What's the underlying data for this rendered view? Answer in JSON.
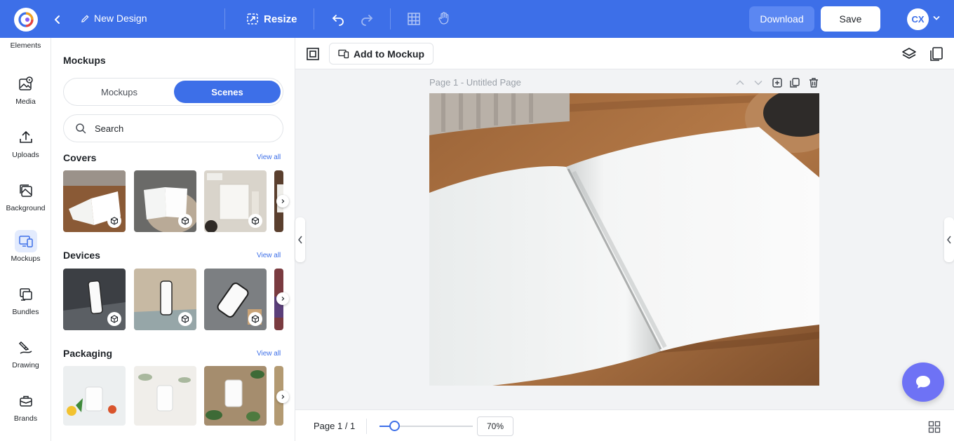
{
  "topbar": {
    "title": "New Design",
    "resize_label": "Resize",
    "download_label": "Download",
    "save_label": "Save",
    "avatar_initials": "CX"
  },
  "rail": {
    "items": [
      {
        "label": "Elements",
        "icon": "elements-icon"
      },
      {
        "label": "Media",
        "icon": "media-icon"
      },
      {
        "label": "Uploads",
        "icon": "upload-icon"
      },
      {
        "label": "Background",
        "icon": "background-icon"
      },
      {
        "label": "Mockups",
        "icon": "mockups-icon",
        "active": true
      },
      {
        "label": "Bundles",
        "icon": "bundles-icon"
      },
      {
        "label": "Drawing",
        "icon": "drawing-icon"
      },
      {
        "label": "Brands",
        "icon": "brands-icon"
      }
    ]
  },
  "panel": {
    "title": "Mockups",
    "tabs": [
      "Mockups",
      "Scenes"
    ],
    "active_tab": "Scenes",
    "search_placeholder": "Search",
    "view_all": "View all",
    "sections": [
      {
        "title": "Covers"
      },
      {
        "title": "Devices"
      },
      {
        "title": "Packaging"
      }
    ]
  },
  "canvas": {
    "add_to_mockup_label": "Add to Mockup",
    "page_label": "Page 1 - Untitled Page",
    "page_count": "Page 1 / 1",
    "zoom_value": "70%",
    "zoom_fraction": 0.16
  },
  "colors": {
    "accent": "#3d6fe8",
    "chat": "#6e72f5"
  }
}
